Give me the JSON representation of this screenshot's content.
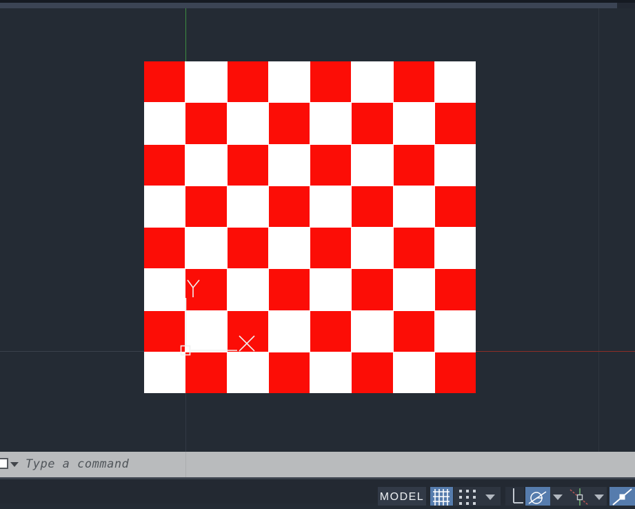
{
  "workspace": {
    "type": "cad-model-space",
    "background_color": "#242b34"
  },
  "drawing": {
    "checkerboard": {
      "rows": 8,
      "cols": 8,
      "first_cell": "red",
      "red_color": "#fc0d06",
      "white_color": "#ffffff"
    },
    "ucs_icon": {
      "x_label": "X",
      "y_label": "Y",
      "color": "#f0f0f0"
    }
  },
  "crosshair": {
    "vertical_color": "#3e8e41",
    "horizontal_left_color": "#3a414c",
    "horizontal_right_color": "#8e2e27"
  },
  "command_bar": {
    "placeholder": "Type a command",
    "background_color": "#b9bbbd",
    "icons": [
      "command-window-icon",
      "dropdown-caret"
    ]
  },
  "status_bar": {
    "model_label": "MODEL",
    "accent_color": "#567cad",
    "buttons": [
      {
        "name": "grid-display",
        "icon": "grid-icon",
        "active": true
      },
      {
        "name": "snap-mode",
        "icon": "snap-dots-icon",
        "active": false
      },
      {
        "name": "ortho-mode",
        "icon": "ortho-icon",
        "active": false
      },
      {
        "name": "polar-tracking",
        "icon": "polar-icon",
        "active": true
      },
      {
        "name": "object-snap-tracking",
        "icon": "autotrack-icon",
        "active": false
      },
      {
        "name": "object-snap",
        "icon": "osnap-icon",
        "active": true
      }
    ]
  }
}
